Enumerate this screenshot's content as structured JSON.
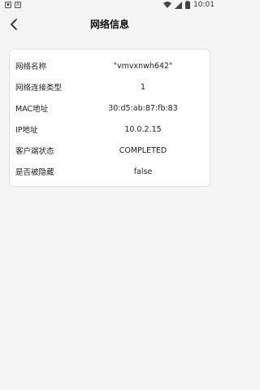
{
  "status_bar": {
    "time": "10:01",
    "icons": [
      "notification-icon",
      "android-icon",
      "wifi-icon",
      "signal-icon",
      "battery-icon"
    ]
  },
  "header": {
    "title": "网络信息",
    "back_icon": "chevron-left-icon"
  },
  "network_info": {
    "rows": [
      {
        "label": "网络名称",
        "value": "\"vmvxnwh642\""
      },
      {
        "label": "网络连接类型",
        "value": "1"
      },
      {
        "label": "MAC地址",
        "value": "30:d5:ab:87:fb:83"
      },
      {
        "label": "IP地址",
        "value": "10.0.2.15"
      },
      {
        "label": "客户端状态",
        "value": "COMPLETED"
      },
      {
        "label": "是否被隐藏",
        "value": "false"
      }
    ]
  }
}
